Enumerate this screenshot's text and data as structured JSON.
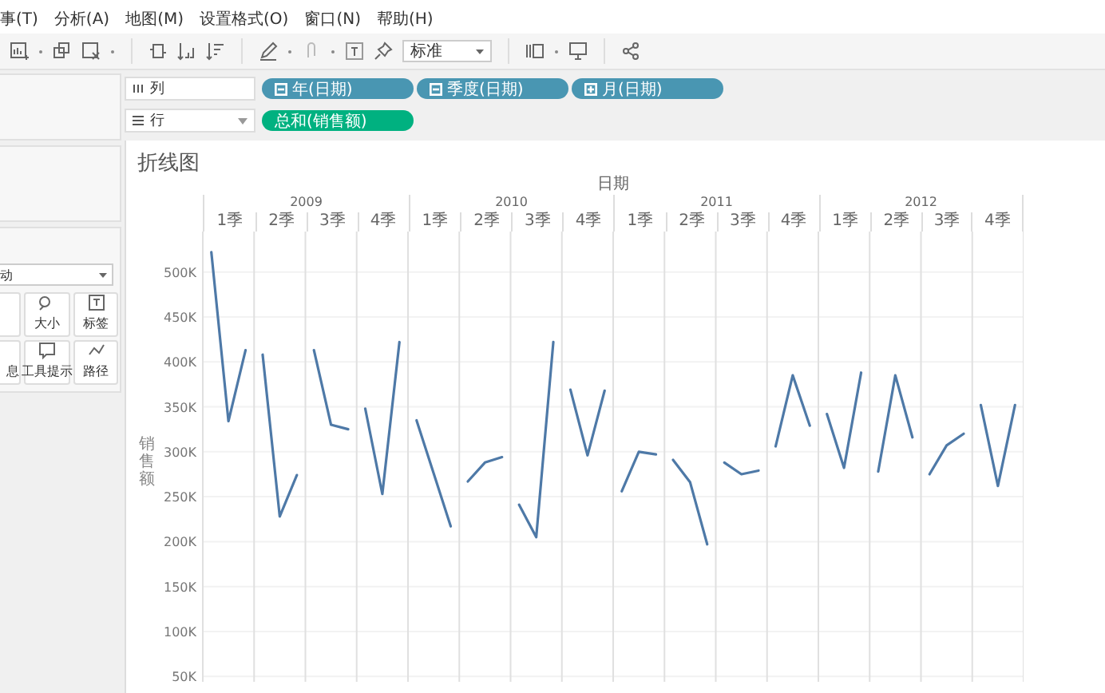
{
  "menu": [
    "事(T)",
    "分析(A)",
    "地图(M)",
    "设置格式(O)",
    "窗口(N)",
    "帮助(H)"
  ],
  "toolbar": {
    "fit_dropdown": "标准"
  },
  "shelves": [
    {
      "kind": "columns",
      "label": "列",
      "pills": [
        {
          "label": "年(日期)",
          "kind": "dimension",
          "expanded": false
        },
        {
          "label": "季度(日期)",
          "kind": "dimension",
          "expanded": false
        },
        {
          "label": "月(日期)",
          "kind": "dimension",
          "expanded": true
        }
      ]
    },
    {
      "kind": "rows",
      "label": "行",
      "pills": [
        {
          "label": "总和(销售额)",
          "kind": "measure"
        }
      ]
    }
  ],
  "marks": {
    "type_dropdown": "动",
    "buttons": [
      {
        "kind": "blank"
      },
      {
        "label": "大小",
        "kind": "size"
      },
      {
        "label": "标签",
        "kind": "label"
      },
      {
        "label": "息",
        "kind": "detail"
      },
      {
        "label": "工具提示",
        "kind": "tooltip"
      },
      {
        "label": "路径",
        "kind": "path"
      }
    ]
  },
  "sheet": {
    "title": "折线图",
    "header_title": "日期",
    "years": [
      {
        "label": "2009",
        "quarters": [
          "1季",
          "2季",
          "3季",
          "4季"
        ]
      },
      {
        "label": "2010",
        "quarters": [
          "1季",
          "2季",
          "3季",
          "4季"
        ]
      },
      {
        "label": "2011",
        "quarters": [
          "1季",
          "2季",
          "3季",
          "4季"
        ]
      },
      {
        "label": "2012",
        "quarters": [
          "1季",
          "2季",
          "3季",
          "4季"
        ]
      }
    ],
    "chart_data": {
      "type": "line",
      "ylabel": "销售额",
      "grid": true,
      "ylim": [
        44000,
        545000
      ],
      "yticks": [
        {
          "value": 50000,
          "label": "50K"
        },
        {
          "value": 100000,
          "label": "100K"
        },
        {
          "value": 150000,
          "label": "150K"
        },
        {
          "value": 200000,
          "label": "200K"
        },
        {
          "value": 250000,
          "label": "250K"
        },
        {
          "value": 300000,
          "label": "300K"
        },
        {
          "value": 350000,
          "label": "350K"
        },
        {
          "value": 400000,
          "label": "400K"
        },
        {
          "value": 450000,
          "label": "450K"
        },
        {
          "value": 500000,
          "label": "500K"
        }
      ],
      "series": [
        {
          "color": "#4e79a7",
          "values": [
            522000,
            334000,
            413000,
            null,
            null,
            null,
            null,
            null,
            null,
            null,
            null,
            null,
            null,
            null,
            null,
            null,
            null,
            null,
            null,
            null,
            null,
            null,
            null,
            null,
            null,
            null,
            null,
            null,
            null,
            null,
            null,
            null,
            null,
            null,
            null,
            null,
            null,
            null,
            null,
            null,
            null,
            null,
            null,
            null,
            null,
            null,
            null,
            null
          ]
        },
        {
          "color": "#4e79a7",
          "values": [
            null,
            null,
            null,
            408000,
            228000,
            274000,
            null,
            null,
            null,
            null,
            null,
            null,
            null,
            null,
            null,
            null,
            null,
            null,
            null,
            null,
            null,
            null,
            null,
            null,
            null,
            null,
            null,
            null,
            null,
            null,
            null,
            null,
            null,
            null,
            null,
            null,
            null,
            null,
            null,
            null,
            null,
            null,
            null,
            null,
            null,
            null,
            null,
            null
          ]
        },
        {
          "color": "#4e79a7",
          "values": [
            null,
            null,
            null,
            null,
            null,
            null,
            413000,
            330000,
            325000,
            null,
            null,
            null,
            null,
            null,
            null,
            null,
            null,
            null,
            null,
            null,
            null,
            null,
            null,
            null,
            null,
            null,
            null,
            null,
            null,
            null,
            null,
            null,
            null,
            null,
            null,
            null,
            null,
            null,
            null,
            null,
            null,
            null,
            null,
            null,
            null,
            null,
            null,
            null
          ]
        },
        {
          "color": "#4e79a7",
          "values": [
            null,
            null,
            null,
            null,
            null,
            null,
            null,
            null,
            null,
            348000,
            253000,
            422000,
            null,
            null,
            null,
            null,
            null,
            null,
            null,
            null,
            null,
            null,
            null,
            null,
            null,
            null,
            null,
            null,
            null,
            null,
            null,
            null,
            null,
            null,
            null,
            null,
            null,
            null,
            null,
            null,
            null,
            null,
            null,
            null,
            null,
            null,
            null,
            null
          ]
        },
        {
          "color": "#4e79a7",
          "values": [
            null,
            null,
            null,
            null,
            null,
            null,
            null,
            null,
            null,
            null,
            null,
            null,
            335000,
            276000,
            217000,
            null,
            null,
            null,
            null,
            null,
            null,
            null,
            null,
            null,
            null,
            null,
            null,
            null,
            null,
            null,
            null,
            null,
            null,
            null,
            null,
            null,
            null,
            null,
            null,
            null,
            null,
            null,
            null,
            null,
            null,
            null,
            null,
            null
          ]
        },
        {
          "color": "#4e79a7",
          "values": [
            null,
            null,
            null,
            null,
            null,
            null,
            null,
            null,
            null,
            null,
            null,
            null,
            null,
            null,
            null,
            267000,
            288000,
            294000,
            null,
            null,
            null,
            null,
            null,
            null,
            null,
            null,
            null,
            null,
            null,
            null,
            null,
            null,
            null,
            null,
            null,
            null,
            null,
            null,
            null,
            null,
            null,
            null,
            null,
            null,
            null,
            null,
            null,
            null
          ]
        },
        {
          "color": "#4e79a7",
          "values": [
            null,
            null,
            null,
            null,
            null,
            null,
            null,
            null,
            null,
            null,
            null,
            null,
            null,
            null,
            null,
            null,
            null,
            null,
            241000,
            205000,
            422000,
            null,
            null,
            null,
            null,
            null,
            null,
            null,
            null,
            null,
            null,
            null,
            null,
            null,
            null,
            null,
            null,
            null,
            null,
            null,
            null,
            null,
            null,
            null,
            null,
            null,
            null,
            null
          ]
        },
        {
          "color": "#4e79a7",
          "values": [
            null,
            null,
            null,
            null,
            null,
            null,
            null,
            null,
            null,
            null,
            null,
            null,
            null,
            null,
            null,
            null,
            null,
            null,
            null,
            null,
            null,
            369000,
            296000,
            368000,
            null,
            null,
            null,
            null,
            null,
            null,
            null,
            null,
            null,
            null,
            null,
            null,
            null,
            null,
            null,
            null,
            null,
            null,
            null,
            null,
            null,
            null,
            null,
            null
          ]
        },
        {
          "color": "#4e79a7",
          "values": [
            null,
            null,
            null,
            null,
            null,
            null,
            null,
            null,
            null,
            null,
            null,
            null,
            null,
            null,
            null,
            null,
            null,
            null,
            null,
            null,
            null,
            null,
            null,
            null,
            256000,
            300000,
            297000,
            null,
            null,
            null,
            null,
            null,
            null,
            null,
            null,
            null,
            null,
            null,
            null,
            null,
            null,
            null,
            null,
            null,
            null,
            null,
            null,
            null
          ]
        },
        {
          "color": "#4e79a7",
          "values": [
            null,
            null,
            null,
            null,
            null,
            null,
            null,
            null,
            null,
            null,
            null,
            null,
            null,
            null,
            null,
            null,
            null,
            null,
            null,
            null,
            null,
            null,
            null,
            null,
            null,
            null,
            null,
            291000,
            266000,
            197000,
            null,
            null,
            null,
            null,
            null,
            null,
            null,
            null,
            null,
            null,
            null,
            null,
            null,
            null,
            null,
            null,
            null,
            null
          ]
        },
        {
          "color": "#4e79a7",
          "values": [
            null,
            null,
            null,
            null,
            null,
            null,
            null,
            null,
            null,
            null,
            null,
            null,
            null,
            null,
            null,
            null,
            null,
            null,
            null,
            null,
            null,
            null,
            null,
            null,
            null,
            null,
            null,
            null,
            null,
            null,
            288000,
            275000,
            279000,
            null,
            null,
            null,
            null,
            null,
            null,
            null,
            null,
            null,
            null,
            null,
            null,
            null,
            null,
            null
          ]
        },
        {
          "color": "#4e79a7",
          "values": [
            null,
            null,
            null,
            null,
            null,
            null,
            null,
            null,
            null,
            null,
            null,
            null,
            null,
            null,
            null,
            null,
            null,
            null,
            null,
            null,
            null,
            null,
            null,
            null,
            null,
            null,
            null,
            null,
            null,
            null,
            null,
            null,
            null,
            306000,
            385000,
            329000,
            null,
            null,
            null,
            null,
            null,
            null,
            null,
            null,
            null,
            null,
            null,
            null
          ]
        },
        {
          "color": "#4e79a7",
          "values": [
            null,
            null,
            null,
            null,
            null,
            null,
            null,
            null,
            null,
            null,
            null,
            null,
            null,
            null,
            null,
            null,
            null,
            null,
            null,
            null,
            null,
            null,
            null,
            null,
            null,
            null,
            null,
            null,
            null,
            null,
            null,
            null,
            null,
            null,
            null,
            null,
            342000,
            282000,
            388000,
            null,
            null,
            null,
            null,
            null,
            null,
            null,
            null,
            null
          ]
        },
        {
          "color": "#4e79a7",
          "values": [
            null,
            null,
            null,
            null,
            null,
            null,
            null,
            null,
            null,
            null,
            null,
            null,
            null,
            null,
            null,
            null,
            null,
            null,
            null,
            null,
            null,
            null,
            null,
            null,
            null,
            null,
            null,
            null,
            null,
            null,
            null,
            null,
            null,
            null,
            null,
            null,
            null,
            null,
            null,
            278000,
            385000,
            316000,
            null,
            null,
            null,
            null,
            null,
            null
          ]
        },
        {
          "color": "#4e79a7",
          "values": [
            null,
            null,
            null,
            null,
            null,
            null,
            null,
            null,
            null,
            null,
            null,
            null,
            null,
            null,
            null,
            null,
            null,
            null,
            null,
            null,
            null,
            null,
            null,
            null,
            null,
            null,
            null,
            null,
            null,
            null,
            null,
            null,
            null,
            null,
            null,
            null,
            null,
            null,
            null,
            null,
            null,
            null,
            275000,
            307000,
            320000,
            null,
            null,
            null
          ]
        },
        {
          "color": "#4e79a7",
          "values": [
            null,
            null,
            null,
            null,
            null,
            null,
            null,
            null,
            null,
            null,
            null,
            null,
            null,
            null,
            null,
            null,
            null,
            null,
            null,
            null,
            null,
            null,
            null,
            null,
            null,
            null,
            null,
            null,
            null,
            null,
            null,
            null,
            null,
            null,
            null,
            null,
            null,
            null,
            null,
            null,
            null,
            null,
            null,
            null,
            null,
            352000,
            262000,
            352000
          ]
        }
      ]
    }
  }
}
